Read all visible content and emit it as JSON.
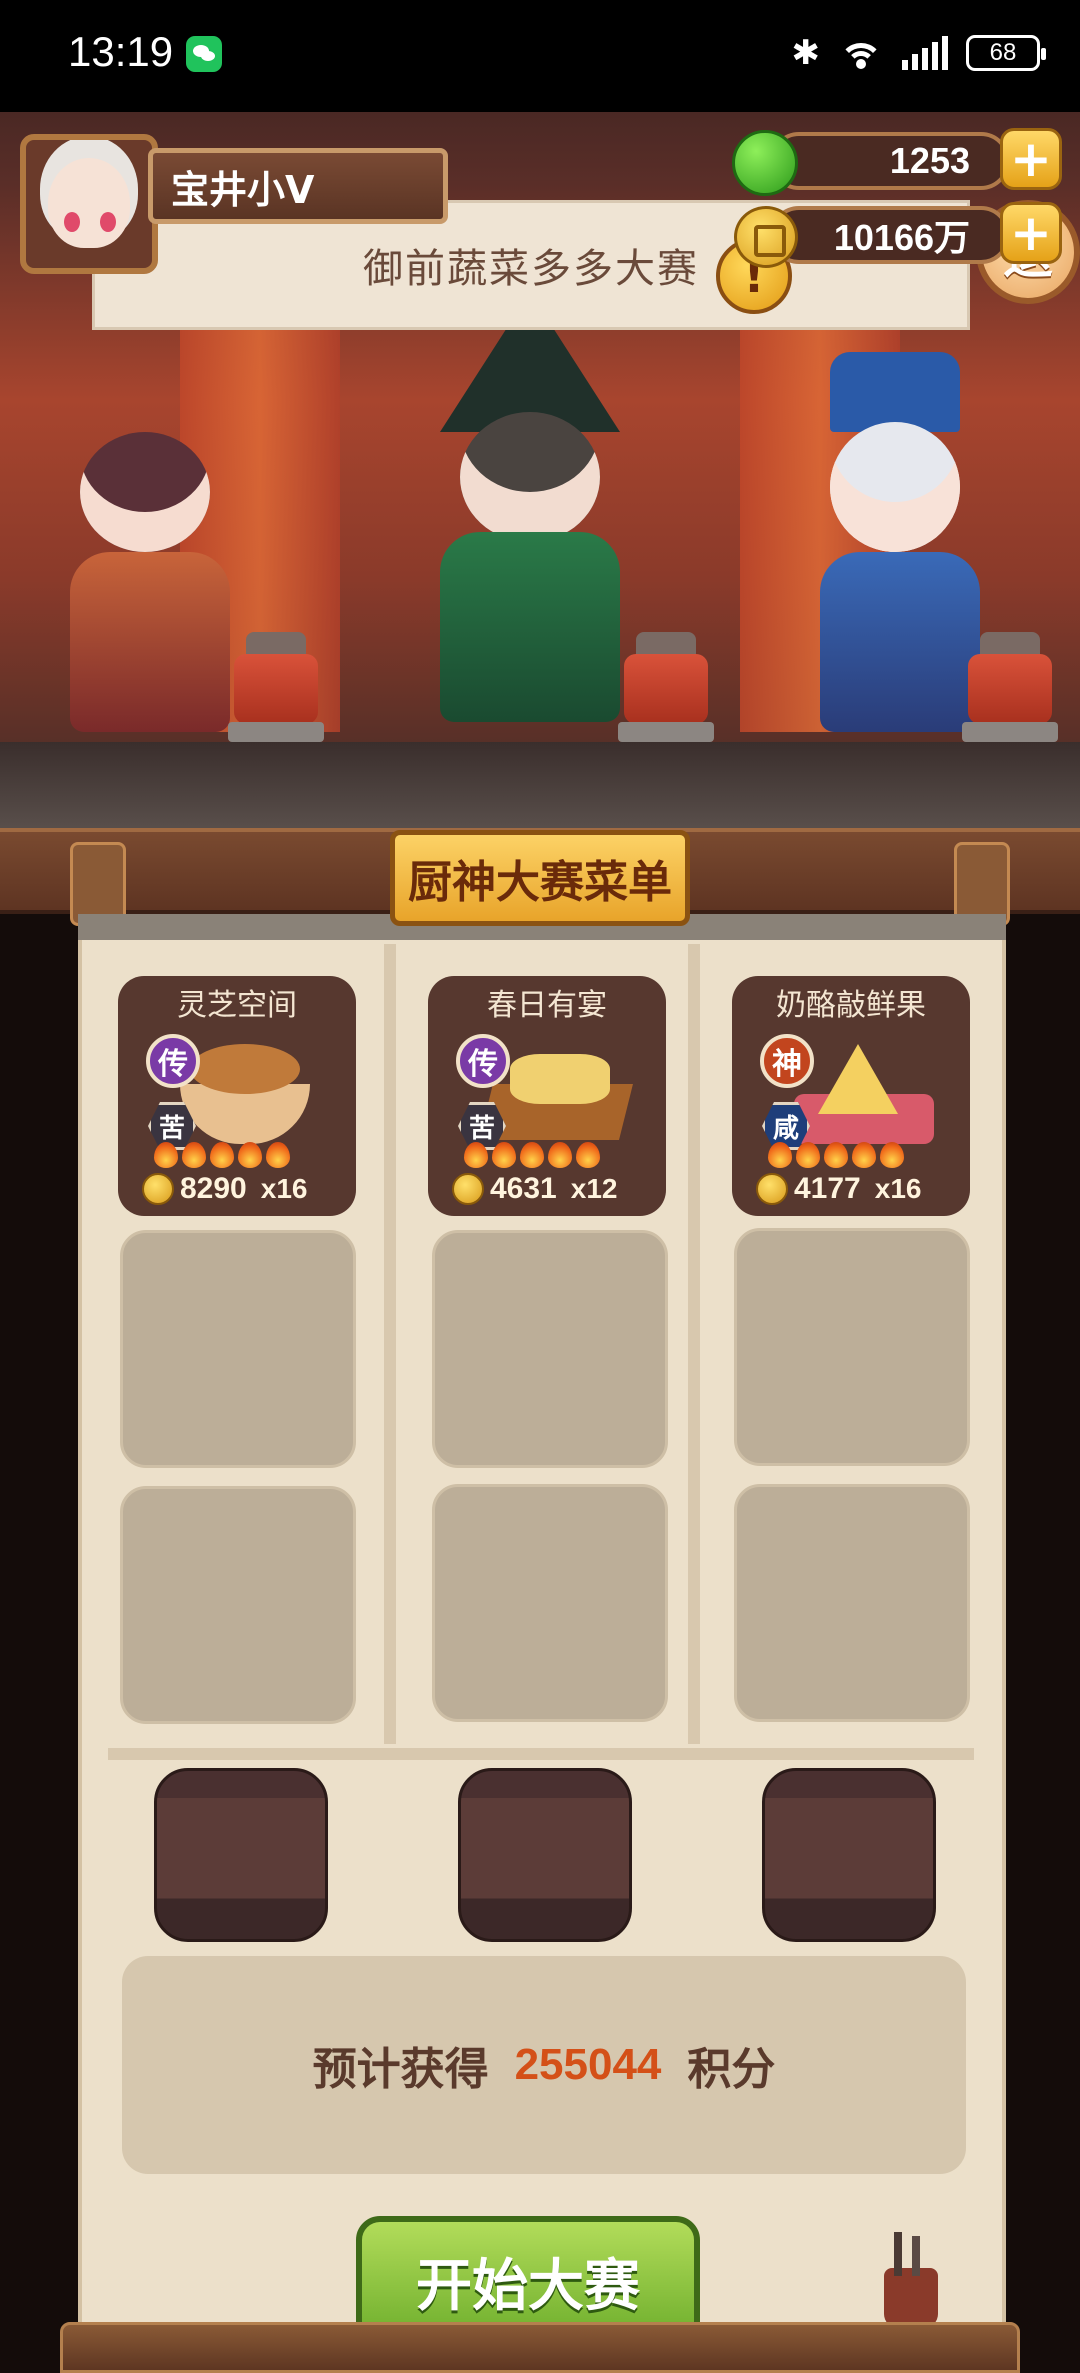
{
  "status_bar": {
    "time": "13:19",
    "battery": "68"
  },
  "player": {
    "name": "宝井小V"
  },
  "resources": {
    "gems": "1253",
    "coins": "10166万"
  },
  "event": {
    "title": "御前蔬菜多多大赛",
    "exit_label": "退"
  },
  "menu": {
    "title": "厨神大赛菜单",
    "dishes": [
      {
        "name": "灵芝空间",
        "rarity": "传",
        "rarity_color": "#7a3aa6",
        "taste": "苦",
        "price": "8290",
        "multiplier": "x16",
        "fires": 5
      },
      {
        "name": "春日有宴",
        "rarity": "传",
        "rarity_color": "#7a3aa6",
        "taste": "苦",
        "price": "4631",
        "multiplier": "x12",
        "fires": 5
      },
      {
        "name": "奶酪敲鲜果",
        "rarity": "神",
        "rarity_color": "#c2451e",
        "taste": "咸",
        "price": "4177",
        "multiplier": "x16",
        "fires": 5
      }
    ]
  },
  "score": {
    "label": "预计获得",
    "value": "255044",
    "unit": "积分"
  },
  "start_button": {
    "label": "开始大赛"
  },
  "colors": {
    "accent_orange": "#d45018",
    "button_green": "#6eae2c",
    "panel_bg": "#ece0ca"
  }
}
